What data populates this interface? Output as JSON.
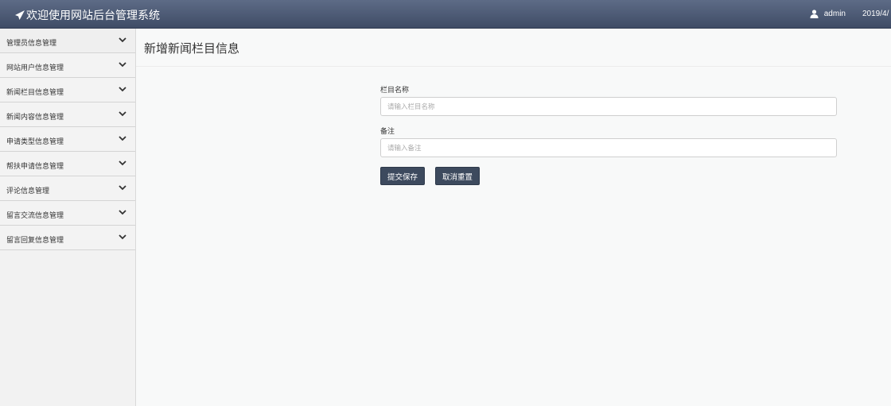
{
  "header": {
    "title": "欢迎使用网站后台管理系统",
    "username": "admin",
    "datetime": "2019/4/"
  },
  "sidebar": {
    "items": [
      {
        "label": "管理员信息管理"
      },
      {
        "label": "网站用户信息管理"
      },
      {
        "label": "新闻栏目信息管理"
      },
      {
        "label": "新闻内容信息管理"
      },
      {
        "label": "申请类型信息管理"
      },
      {
        "label": "帮扶申请信息管理"
      },
      {
        "label": "评论信息管理"
      },
      {
        "label": "留言交流信息管理"
      },
      {
        "label": "留言回复信息管理"
      }
    ]
  },
  "main": {
    "page_title": "新增新闻栏目信息",
    "form": {
      "name_label": "栏目名称",
      "name_placeholder": "请输入栏目名称",
      "name_value": "",
      "remark_label": "备注",
      "remark_placeholder": "请输入备注",
      "remark_value": "",
      "submit_label": "提交保存",
      "reset_label": "取消重置"
    }
  },
  "colors": {
    "topbar": "#4a5773",
    "button": "#3d4a5e",
    "sidebar": "#f2f2f2"
  },
  "icons": {
    "brand": "paper-plane-icon",
    "user": "user-icon",
    "menu_toggle": "chevron-down-icon"
  }
}
